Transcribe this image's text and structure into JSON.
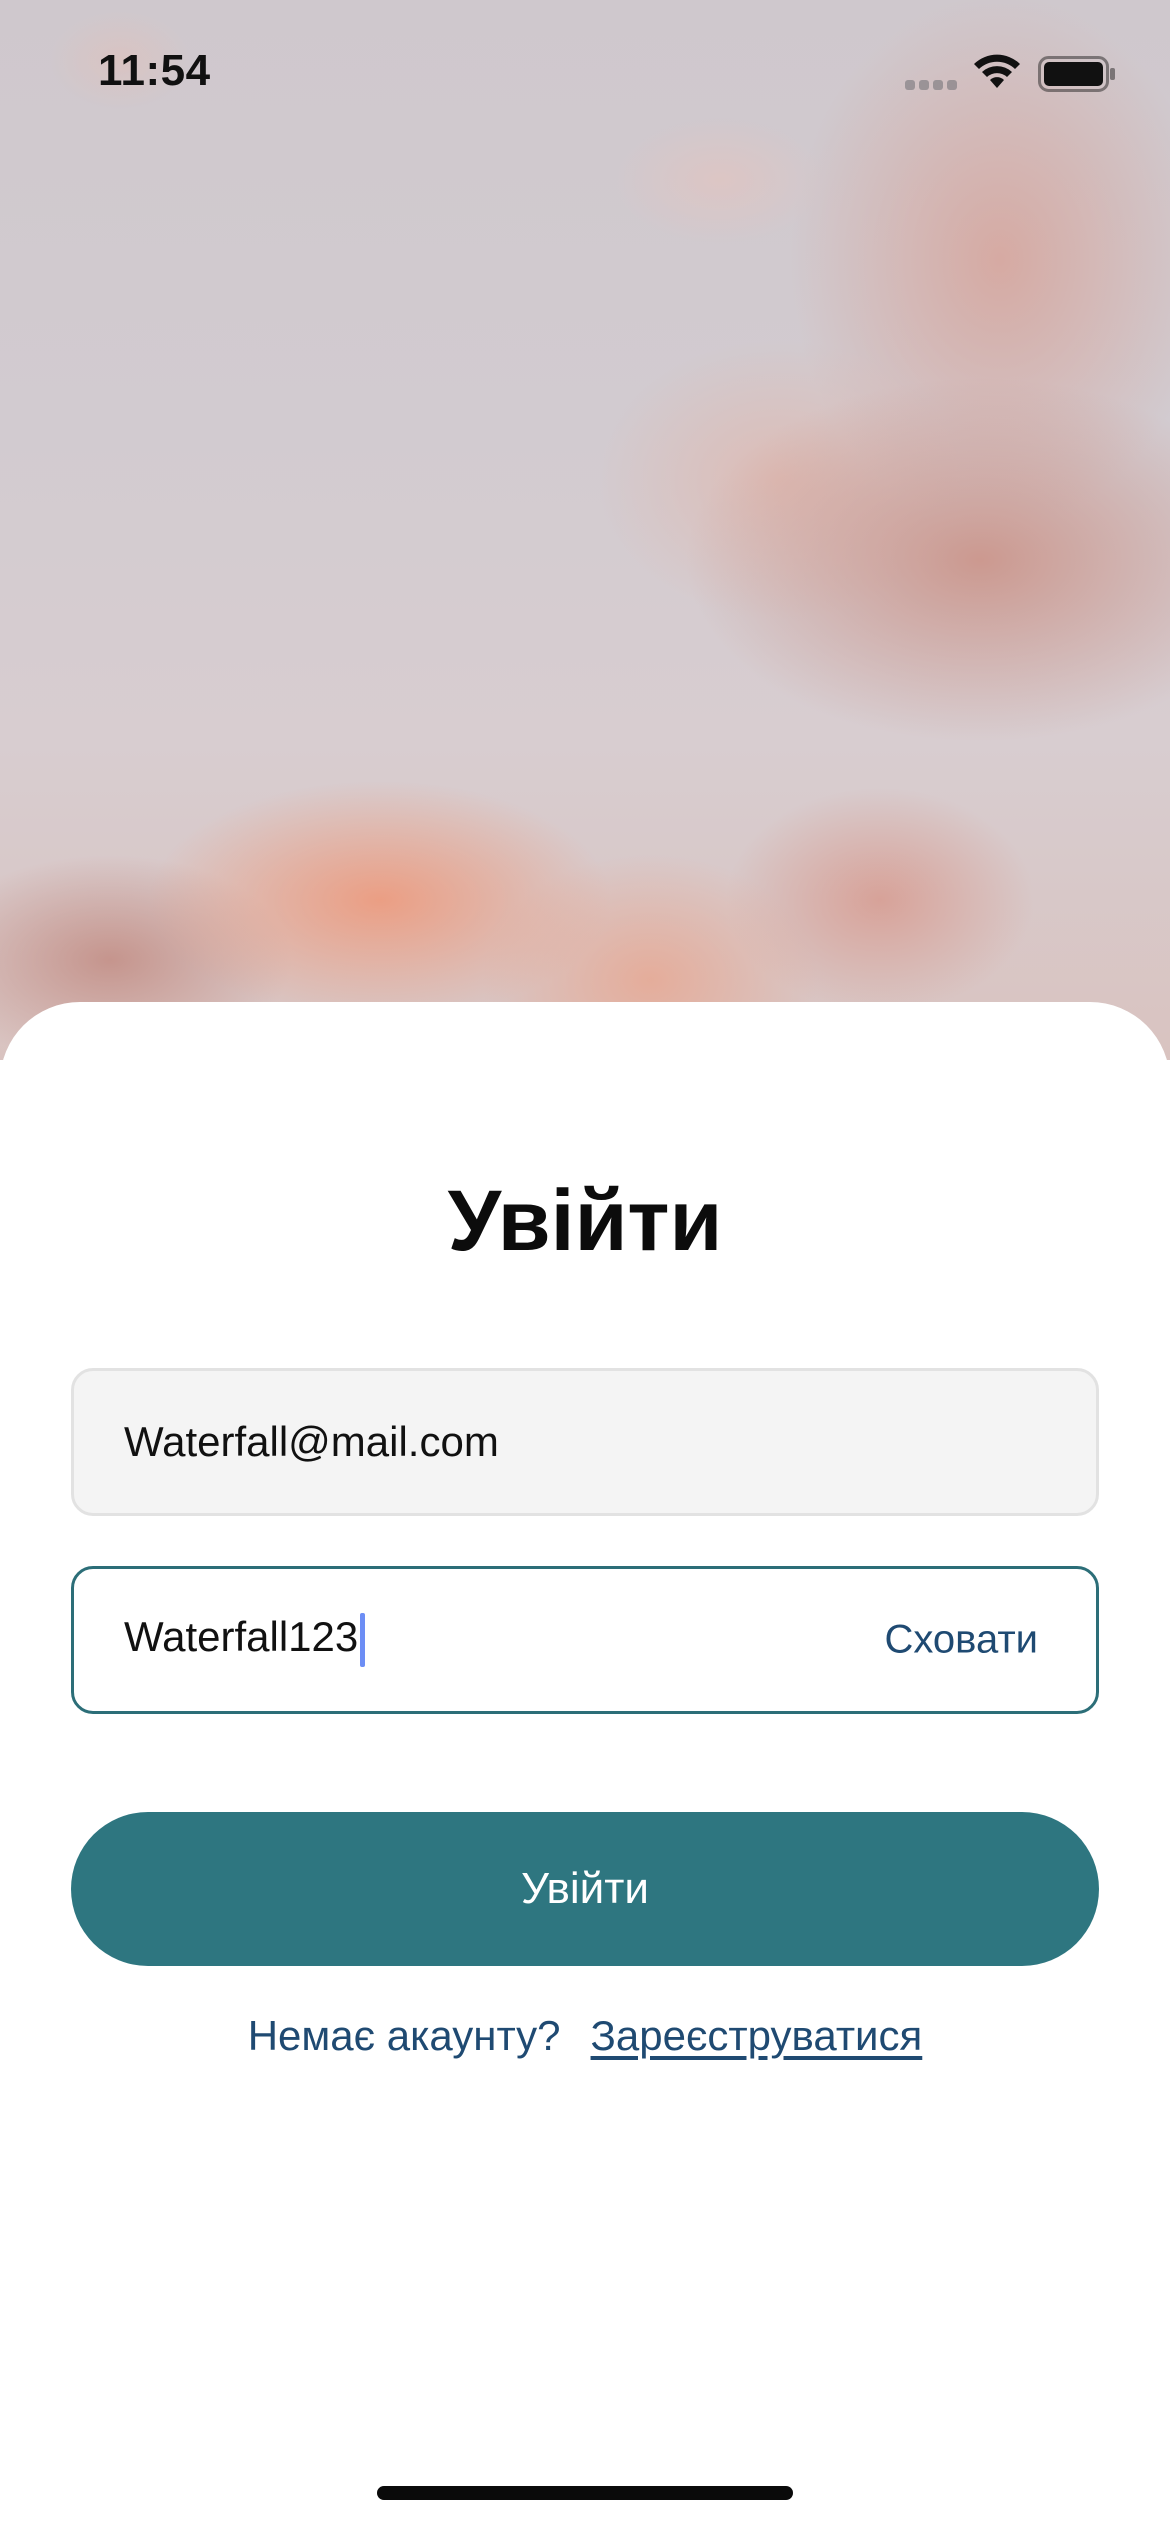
{
  "status_bar": {
    "time": "11:54",
    "signal_icon": "cellular-signal-icon",
    "wifi_icon": "wifi-icon",
    "battery_icon": "battery-icon"
  },
  "background": {
    "image": "pink-clouds-sky"
  },
  "login": {
    "title": "Увійти",
    "email_value": "Waterfall@mail.com",
    "password_value": "Waterfall123",
    "hide_label": "Сховати",
    "submit_label": "Увійти",
    "no_account_text": "Немає акаунту?",
    "register_link": "Зареєструватися"
  },
  "colors": {
    "accent": "#2e7680",
    "link": "#1f4a72",
    "field_fill": "#f4f4f4",
    "cursor": "#6d8ef5"
  }
}
